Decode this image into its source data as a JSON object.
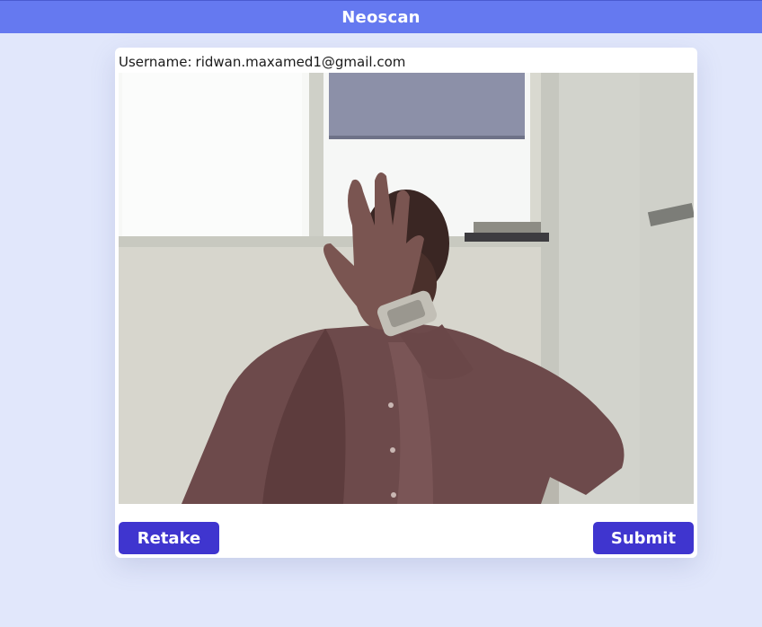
{
  "app": {
    "title": "Neoscan"
  },
  "form": {
    "username_label": "Username:",
    "username_value": "ridwan.maxamed1@gmail.com"
  },
  "camera": {
    "feed_icon": "webcam-capture-image"
  },
  "actions": {
    "retake_label": "Retake",
    "submit_label": "Submit"
  },
  "colors": {
    "header": "#6579f0",
    "background": "#e1e7fb",
    "button": "#3f35cf"
  }
}
